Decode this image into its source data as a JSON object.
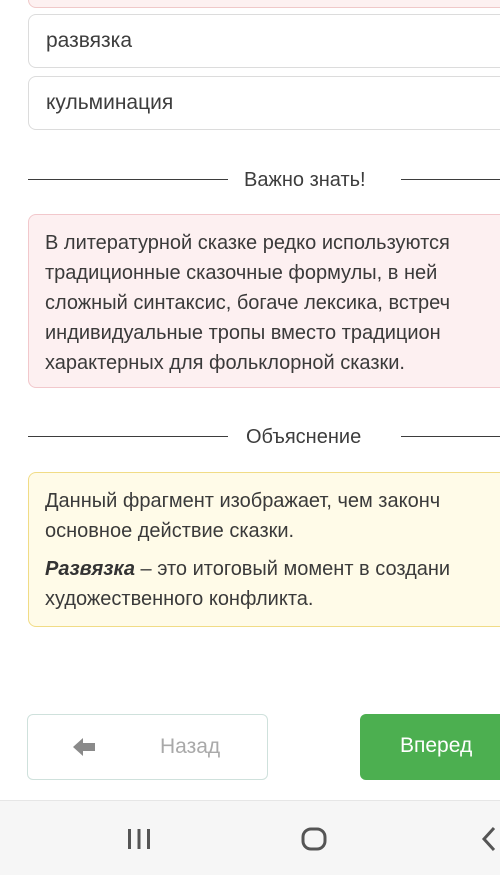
{
  "options": [
    {
      "label": "развязка"
    },
    {
      "label": "кульминация"
    }
  ],
  "important": {
    "heading": "Важно знать!",
    "lines": [
      "В литературной сказке редко используются",
      "традиционные сказочные формулы, в ней",
      "сложный синтаксис, богаче лексика, встреч",
      "индивидуальные тропы вместо традицион",
      "характерных для фольклорной сказки."
    ]
  },
  "explanation": {
    "heading": "Объяснение",
    "line1": "Данный фрагмент изображает, чем законч",
    "line2": "основное действие сказки.",
    "term": "Развязка",
    "term_rest": " – это итоговый момент в создани",
    "line4": "художественного конфликта."
  },
  "buttons": {
    "back_label": "Назад",
    "next_label": "Вперед"
  },
  "nav": {
    "icons": [
      "recent-apps-icon",
      "home-icon",
      "back-icon"
    ]
  },
  "colors": {
    "accent_green": "#4caf50",
    "important_bg": "#fdf0f1",
    "explain_bg": "#fffbe8"
  }
}
